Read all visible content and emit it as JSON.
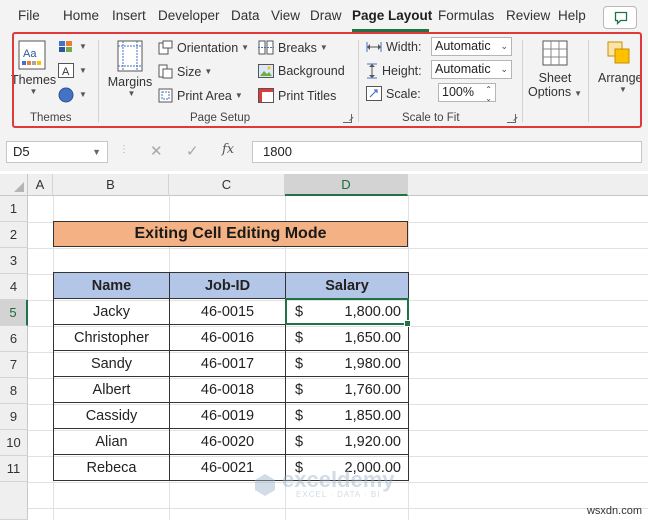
{
  "menu": {
    "items": [
      "File",
      "Home",
      "Insert",
      "Developer",
      "Data",
      "View",
      "Draw",
      "Page Layout",
      "Formulas",
      "Review",
      "Help"
    ],
    "active": "Page Layout"
  },
  "ribbon": {
    "themes_group": {
      "themes_label": "Themes",
      "group_label": "Themes"
    },
    "page_setup": {
      "margins_label": "Margins",
      "orientation_label": "Orientation",
      "size_label": "Size",
      "print_area_label": "Print Area",
      "breaks_label": "Breaks",
      "background_label": "Background",
      "print_titles_label": "Print Titles",
      "group_label": "Page Setup"
    },
    "scale_to_fit": {
      "width_label": "Width:",
      "width_value": "Automatic",
      "height_label": "Height:",
      "height_value": "Automatic",
      "scale_label": "Scale:",
      "scale_value": "100%",
      "group_label": "Scale to Fit"
    },
    "sheet_options": {
      "line1": "Sheet",
      "line2": "Options"
    },
    "arrange": {
      "label": "Arrange"
    }
  },
  "formula_bar": {
    "name_box": "D5",
    "fx": "fx",
    "value": "1800"
  },
  "sheet": {
    "columns": [
      "A",
      "B",
      "C",
      "D"
    ],
    "rows": [
      "1",
      "2",
      "3",
      "4",
      "5",
      "6",
      "7",
      "8",
      "9",
      "10",
      "11"
    ],
    "selected_column": "D",
    "selected_row": "5",
    "title": "Exiting Cell Editing Mode",
    "table": {
      "headers": [
        "Name",
        "Job-ID",
        "Salary"
      ],
      "rows": [
        {
          "name": "Jacky",
          "job_id": "46-0015",
          "currency": "$",
          "salary": "1,800.00"
        },
        {
          "name": "Christopher",
          "job_id": "46-0016",
          "currency": "$",
          "salary": "1,650.00"
        },
        {
          "name": "Sandy",
          "job_id": "46-0017",
          "currency": "$",
          "salary": "1,980.00"
        },
        {
          "name": "Albert",
          "job_id": "46-0018",
          "currency": "$",
          "salary": "1,760.00"
        },
        {
          "name": "Cassidy",
          "job_id": "46-0019",
          "currency": "$",
          "salary": "1,850.00"
        },
        {
          "name": "Alian",
          "job_id": "46-0020",
          "currency": "$",
          "salary": "1,920.00"
        },
        {
          "name": "Rebeca",
          "job_id": "46-0021",
          "currency": "$",
          "salary": "2,000.00"
        }
      ]
    }
  },
  "watermark": {
    "title": "exceldemy",
    "subtitle": "EXCEL · DATA · BI"
  },
  "source_label": "wsxdn.com",
  "colors": {
    "accent_green": "#217346",
    "title_fill": "#f4b183",
    "header_fill": "#b4c6e7",
    "highlight_outline": "#e0393b"
  }
}
